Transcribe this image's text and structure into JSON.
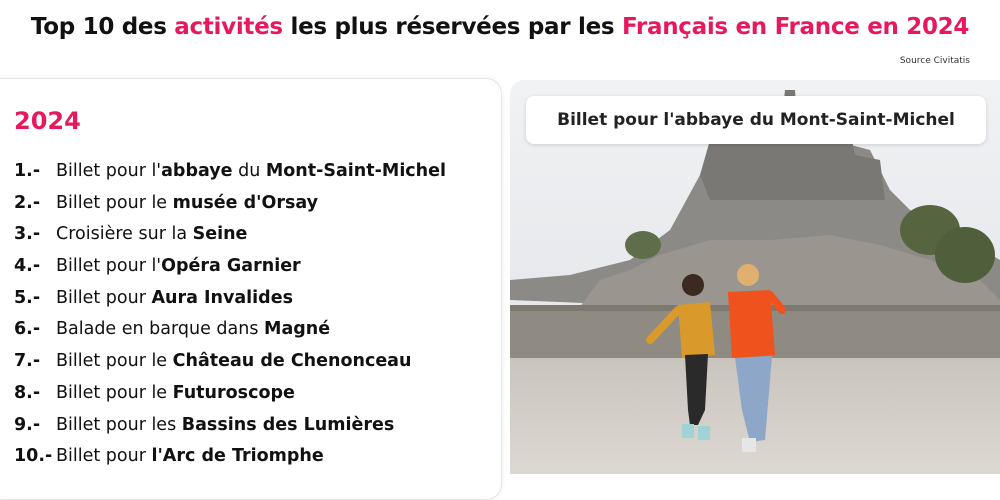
{
  "title": {
    "part1": "Top 10 des ",
    "part2": "activités",
    "part3": " les plus réservées par les ",
    "part4": "Français en France en 2024"
  },
  "source": "Source Civitatis",
  "year": "2024",
  "items": [
    {
      "num": "1.-",
      "parts": [
        {
          "t": "Billet pour l'",
          "b": false
        },
        {
          "t": "abbaye",
          "b": true
        },
        {
          "t": " du ",
          "b": false
        },
        {
          "t": "Mont-Saint-Michel",
          "b": true
        }
      ]
    },
    {
      "num": "2.-",
      "parts": [
        {
          "t": "Billet pour le ",
          "b": false
        },
        {
          "t": "musée d'Orsay",
          "b": true
        }
      ]
    },
    {
      "num": "3.-",
      "parts": [
        {
          "t": "Croisière sur la ",
          "b": false
        },
        {
          "t": "Seine",
          "b": true
        }
      ]
    },
    {
      "num": "4.-",
      "parts": [
        {
          "t": "Billet pour l'",
          "b": false
        },
        {
          "t": "Opéra Garnier",
          "b": true
        }
      ]
    },
    {
      "num": "5.-",
      "parts": [
        {
          "t": "Billet pour ",
          "b": false
        },
        {
          "t": "Aura Invalides",
          "b": true
        }
      ]
    },
    {
      "num": "6.-",
      "parts": [
        {
          "t": "Balade en barque dans ",
          "b": false
        },
        {
          "t": "Magné",
          "b": true
        }
      ]
    },
    {
      "num": "7.-",
      "parts": [
        {
          "t": "Billet pour le ",
          "b": false
        },
        {
          "t": "Château de Chenonceau",
          "b": true
        }
      ]
    },
    {
      "num": "8.-",
      "parts": [
        {
          "t": "Billet pour le ",
          "b": false
        },
        {
          "t": "Futuroscope",
          "b": true
        }
      ]
    },
    {
      "num": "9.-",
      "parts": [
        {
          "t": "Billet pour les ",
          "b": false
        },
        {
          "t": "Bassins des Lumières",
          "b": true
        }
      ]
    },
    {
      "num": "10.-",
      "parts": [
        {
          "t": "Billet pour ",
          "b": false
        },
        {
          "t": "l'Arc de Triomphe",
          "b": true
        }
      ]
    }
  ],
  "photo_caption": "Billet pour l'abbaye du Mont-Saint-Michel",
  "colors": {
    "accent": "#e6195f"
  }
}
